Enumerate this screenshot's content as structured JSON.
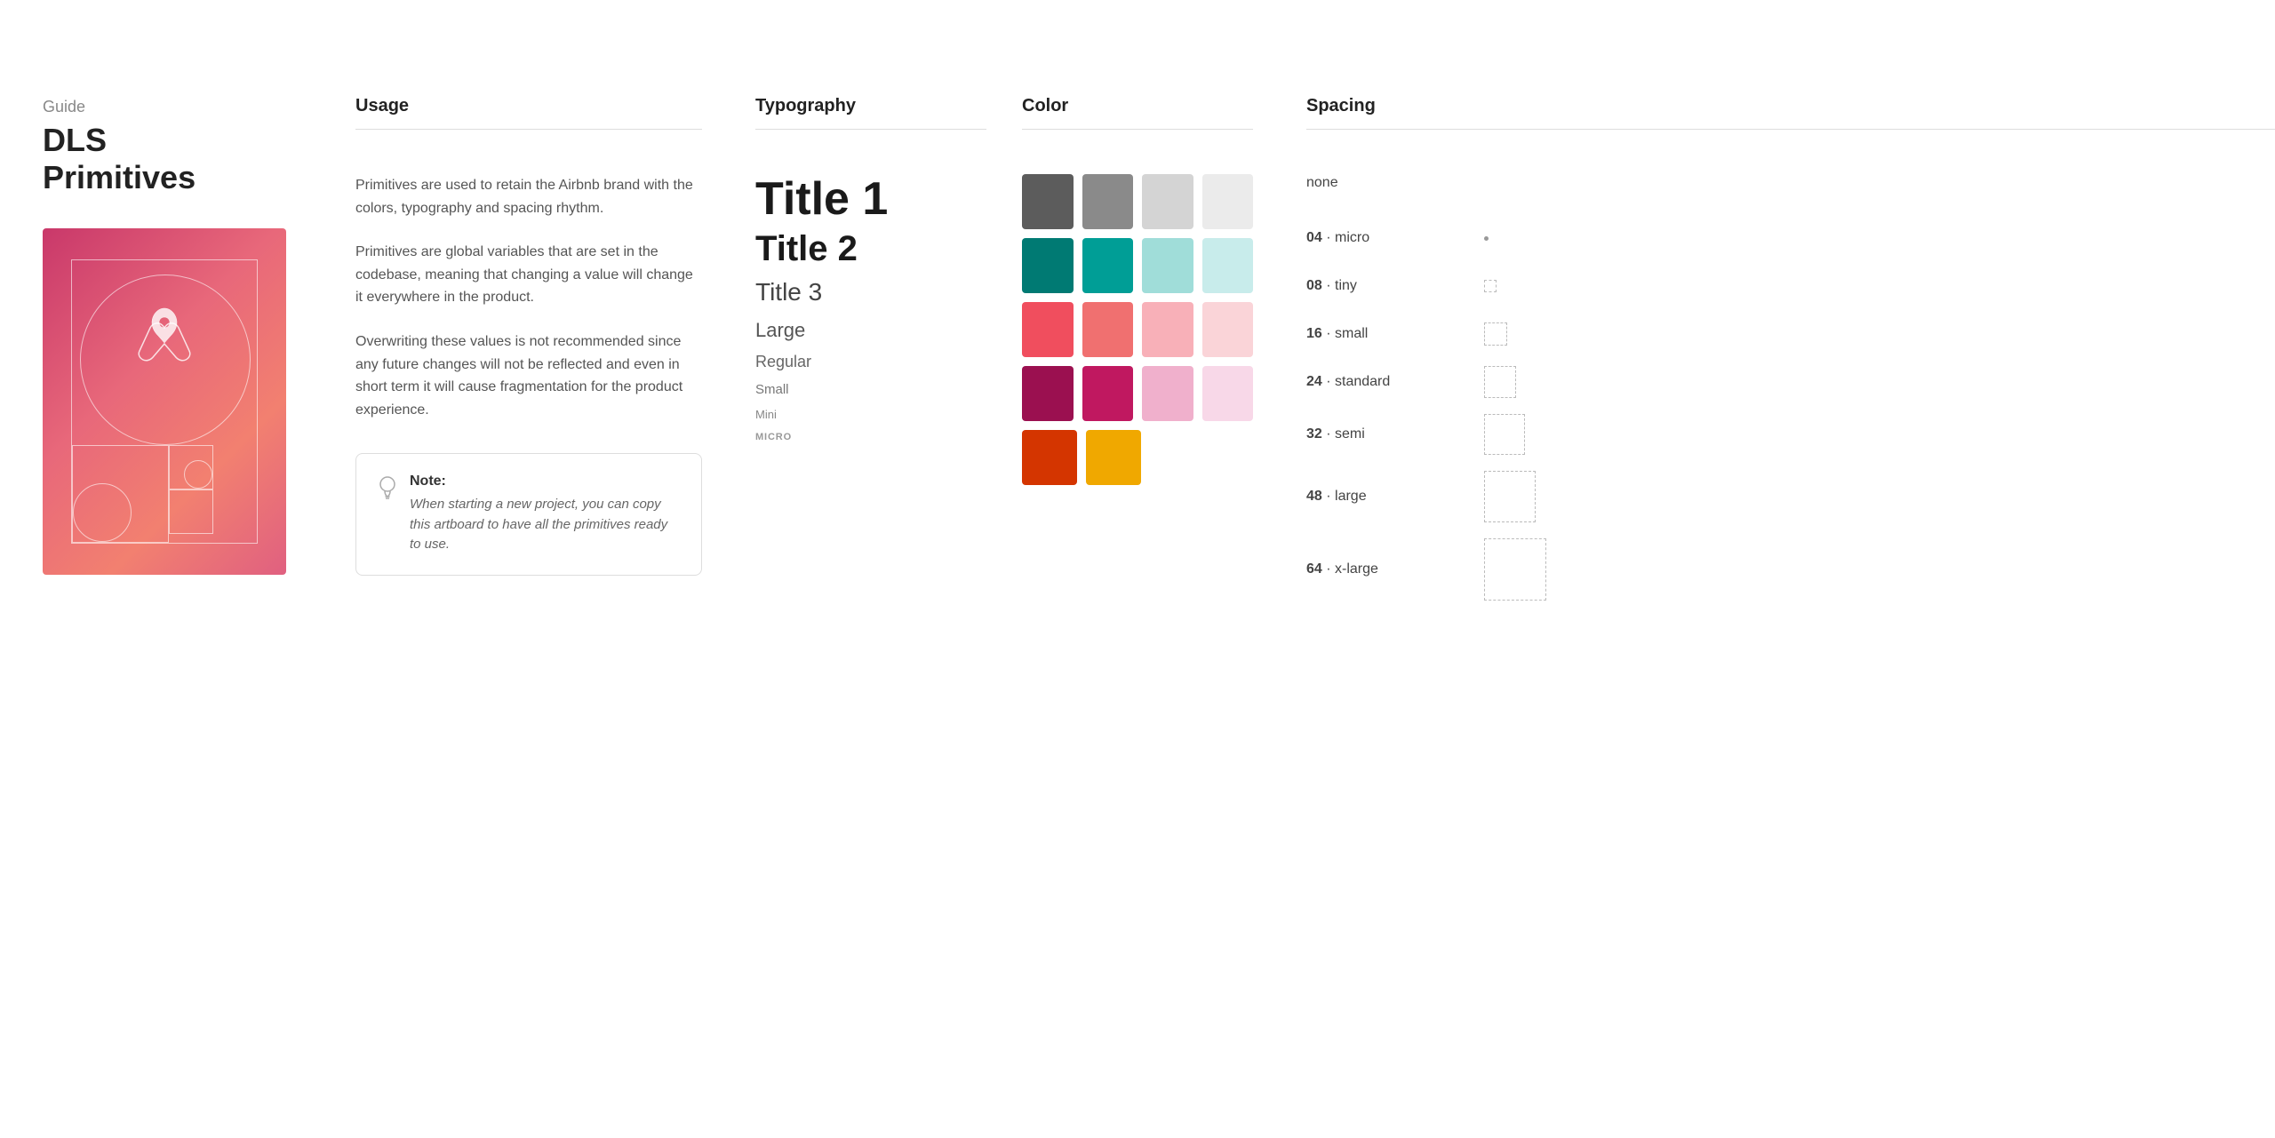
{
  "sidebar": {
    "guide_label": "Guide",
    "brand_title": "DLS Primitives"
  },
  "sections": {
    "usage": {
      "header": "Usage",
      "paragraphs": [
        "Primitives are used to retain the Airbnb brand with  the colors, typography and spacing rhythm.",
        "Primitives are global variables that are set in the codebase, meaning that changing a value will change it everywhere in the product.",
        "Overwriting these values is not recommended since any future changes will not be reflected and even in short term it will cause fragmentation for the product experience."
      ],
      "note": {
        "title": "Note:",
        "text": "When starting a new project, you can copy this artboard to have all the primitives ready to use."
      }
    },
    "typography": {
      "header": "Typography",
      "items": [
        {
          "label": "Title 1",
          "class": "typo-title1"
        },
        {
          "label": "Title 2",
          "class": "typo-title2"
        },
        {
          "label": "Title 3",
          "class": "typo-title3"
        },
        {
          "label": "Large",
          "class": "typo-large"
        },
        {
          "label": "Regular",
          "class": "typo-regular"
        },
        {
          "label": "Small",
          "class": "typo-small"
        },
        {
          "label": "Mini",
          "class": "typo-mini"
        },
        {
          "label": "MICRO",
          "class": "typo-micro"
        }
      ]
    },
    "color": {
      "header": "Color",
      "rows": [
        [
          "#5c5c5c",
          "#8a8a8a",
          "#d4d4d4",
          "#ebebeb"
        ],
        [
          "#007a73",
          "#009e96",
          "#a0ddd9",
          "#c8eceb"
        ],
        [
          "#f04e5e",
          "#f07070",
          "#f8b0b8",
          "#fad4d8"
        ],
        [
          "#9b1050",
          "#c01860",
          "#f0b0cc",
          "#f8d8e8"
        ],
        [
          "#d43500",
          "#f0a800",
          "",
          ""
        ]
      ]
    },
    "spacing": {
      "header": "Spacing",
      "items": [
        {
          "label": "none",
          "size": 0,
          "name": "none"
        },
        {
          "label": "04",
          "sublabel": "micro",
          "size": 4,
          "name": "micro"
        },
        {
          "label": "08",
          "sublabel": "tiny",
          "size": 8,
          "name": "tiny"
        },
        {
          "label": "16",
          "sublabel": "small",
          "size": 16,
          "name": "small"
        },
        {
          "label": "24",
          "sublabel": "standard",
          "size": 24,
          "name": "standard"
        },
        {
          "label": "32",
          "sublabel": "semi",
          "size": 32,
          "name": "semi"
        },
        {
          "label": "48",
          "sublabel": "large",
          "size": 48,
          "name": "large"
        },
        {
          "label": "64",
          "sublabel": "x-large",
          "size": 64,
          "name": "x-large"
        }
      ]
    }
  }
}
